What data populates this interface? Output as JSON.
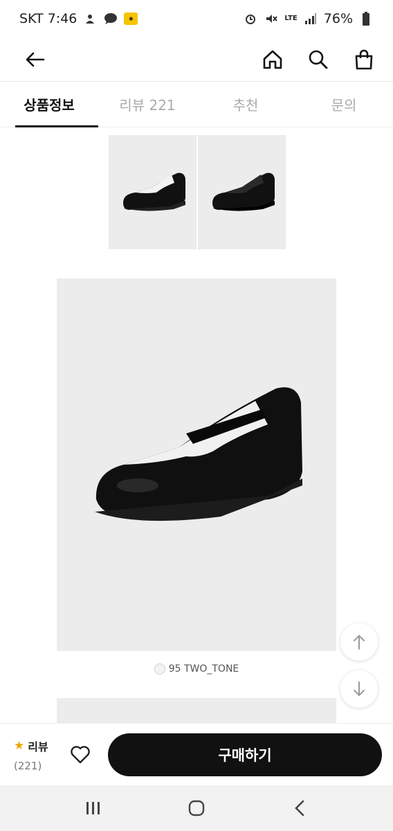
{
  "status_bar": {
    "carrier_time": "SKT 7:46",
    "network": "LTE",
    "battery": "76%"
  },
  "header": {
    "back_icon": "arrow-left-icon",
    "home_icon": "home-icon",
    "search_icon": "search-icon",
    "bag_icon": "shopping-bag-icon"
  },
  "tabs": [
    {
      "label": "상품정보",
      "active": true
    },
    {
      "label": "리뷰 221",
      "active": false
    },
    {
      "label": "추천",
      "active": false
    },
    {
      "label": "문의",
      "active": false
    }
  ],
  "product": {
    "color_option": "95 TWO_TONE"
  },
  "purchase_bar": {
    "review_label": "리뷰",
    "review_count": "(221)",
    "buy_label": "구매하기"
  },
  "colors": {
    "accent": "#111111",
    "star": "#f0a500",
    "image_bg": "#ececec"
  }
}
